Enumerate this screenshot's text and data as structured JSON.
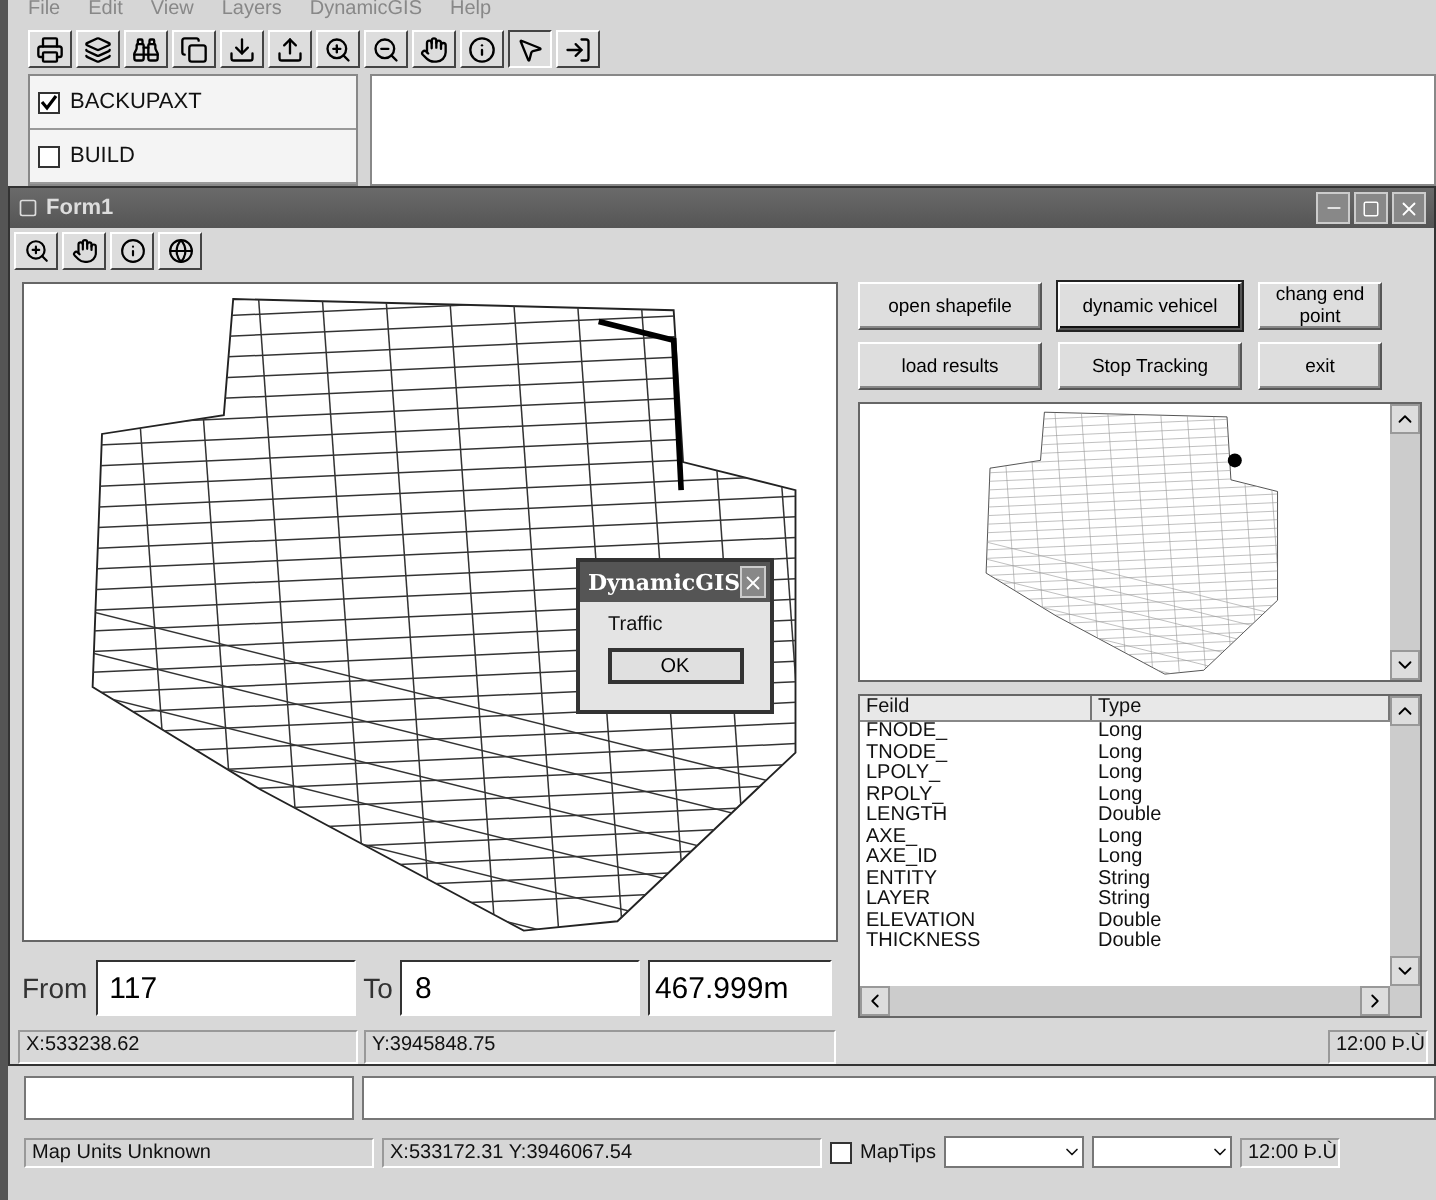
{
  "menu": [
    "File",
    "Edit",
    "View",
    "Layers",
    "DynamicGIS",
    "Help"
  ],
  "layers": [
    {
      "name": "BACKUPAXT",
      "checked": true
    },
    {
      "name": "BUILD",
      "checked": false
    }
  ],
  "form": {
    "title": "Form1",
    "buttons": [
      {
        "label": "open shapefile",
        "selected": false
      },
      {
        "label": "dynamic vehicel",
        "selected": true
      },
      {
        "label": "chang end point",
        "selected": false
      },
      {
        "label": "load results",
        "selected": false
      },
      {
        "label": "Stop Tracking",
        "selected": false
      },
      {
        "label": "exit",
        "selected": false
      }
    ],
    "dialog": {
      "title": "DynamicGIS",
      "message": "Traffic",
      "button": "OK"
    },
    "table": {
      "columns": [
        "Feild",
        "Type"
      ],
      "rows": [
        [
          "FNODE_",
          "Long"
        ],
        [
          "TNODE_",
          "Long"
        ],
        [
          "LPOLY_",
          "Long"
        ],
        [
          "RPOLY_",
          "Long"
        ],
        [
          "LENGTH",
          "Double"
        ],
        [
          "AXE_",
          "Long"
        ],
        [
          "AXE_ID",
          "Long"
        ],
        [
          "ENTITY",
          "String"
        ],
        [
          "LAYER",
          "String"
        ],
        [
          "ELEVATION",
          "Double"
        ],
        [
          "THICKNESS",
          "Double"
        ]
      ]
    },
    "route": {
      "from_label": "From",
      "from_value": "117",
      "to_label": "To",
      "to_value": "8",
      "distance": "467.999m"
    },
    "status": {
      "x": "X:533238.62",
      "y": "Y:3945848.75",
      "time": "12:00 Þ.Ù"
    }
  },
  "status_bar": {
    "units": "Map Units Unknown",
    "coords": "X:533172.31 Y:3946067.54",
    "maptips": {
      "label": "MapTips",
      "checked": false
    },
    "time": "12:00 Þ.Ù"
  }
}
